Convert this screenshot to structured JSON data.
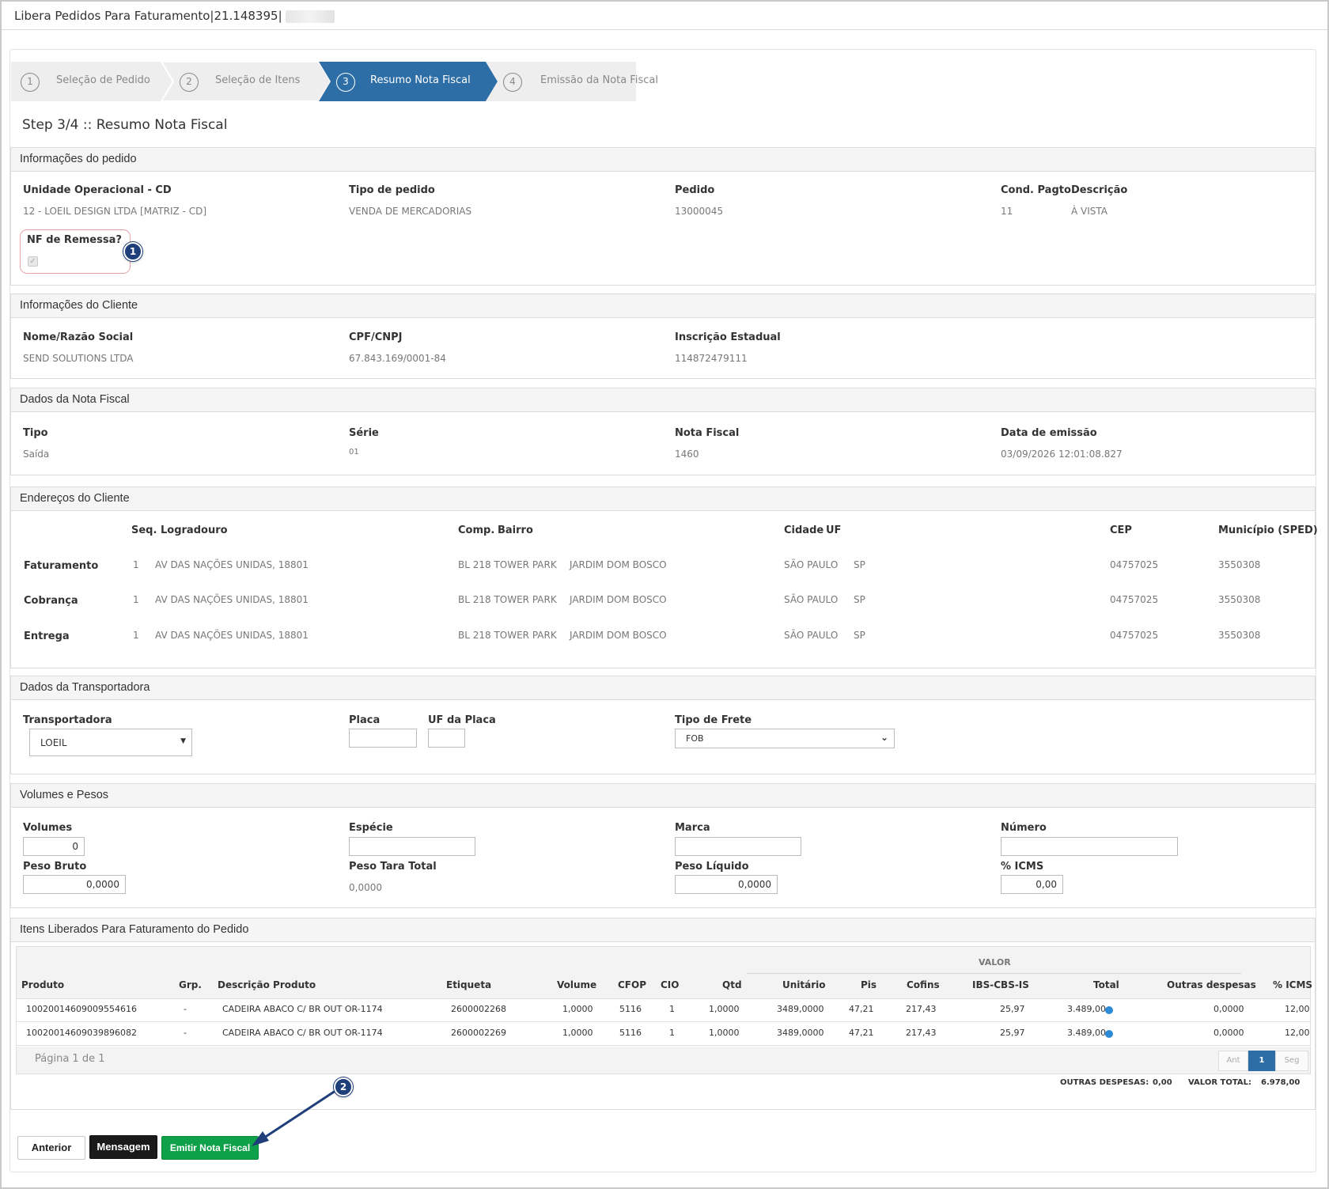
{
  "window": {
    "title": "Libera Pedidos Para Faturamento|21.148395|"
  },
  "wizard": {
    "steps": [
      {
        "num": "1",
        "label": "Seleção de Pedido"
      },
      {
        "num": "2",
        "label": "Seleção de Itens"
      },
      {
        "num": "3",
        "label": "Resumo Nota Fiscal"
      },
      {
        "num": "4",
        "label": "Emissão da Nota Fiscal"
      }
    ]
  },
  "step_title": "Step 3/4 :: Resumo Nota Fiscal",
  "pedido": {
    "header": "Informações do pedido",
    "unidade_label": "Unidade Operacional - CD",
    "unidade_value": "12 - LOEIL DESIGN LTDA [MATRIZ - CD]",
    "tipo_label": "Tipo de pedido",
    "tipo_value": "VENDA DE MERCADORIAS",
    "pedido_label": "Pedido",
    "pedido_value": "13000045",
    "cond_label": "Cond. Pagto",
    "cond_value": "11",
    "desc_label": "Descrição",
    "desc_value": "À VISTA",
    "remessa_label": "NF de Remessa?",
    "badge1": "1"
  },
  "cliente": {
    "header": "Informações do Cliente",
    "nome_label": "Nome/Razão Social",
    "nome_value": "SEND SOLUTIONS LTDA",
    "cpf_label": "CPF/CNPJ",
    "cpf_value": "67.843.169/0001-84",
    "ie_label": "Inscrição Estadual",
    "ie_value": "114872479111"
  },
  "nota": {
    "header": "Dados da Nota Fiscal",
    "tipo_label": "Tipo",
    "tipo_value": "Saída",
    "serie_label": "Série",
    "serie_value": "01",
    "nf_label": "Nota Fiscal",
    "nf_value": "1460",
    "data_label": "Data de emissão",
    "data_value": "03/09/2026 12:01:08.827"
  },
  "enderecos": {
    "header": "Endereços do Cliente",
    "cols": {
      "seq": "Seq.",
      "logradouro": "Logradouro",
      "comp": "Comp.",
      "bairro": "Bairro",
      "cidade": "Cidade",
      "uf": "UF",
      "cep": "CEP",
      "municipio": "Município (SPED)"
    },
    "rows": [
      {
        "tipo": "Faturamento",
        "seq": "1",
        "logradouro": "AV DAS NAÇÕES UNIDAS, 18801",
        "comp": "BL 218 TOWER PARK",
        "bairro": "JARDIM DOM BOSCO",
        "cidade": "SÃO PAULO",
        "uf": "SP",
        "cep": "04757025",
        "municipio": "3550308"
      },
      {
        "tipo": "Cobrança",
        "seq": "1",
        "logradouro": "AV DAS NAÇÕES UNIDAS, 18801",
        "comp": "BL 218 TOWER PARK",
        "bairro": "JARDIM DOM BOSCO",
        "cidade": "SÃO PAULO",
        "uf": "SP",
        "cep": "04757025",
        "municipio": "3550308"
      },
      {
        "tipo": "Entrega",
        "seq": "1",
        "logradouro": "AV DAS NAÇÕES UNIDAS, 18801",
        "comp": "BL 218 TOWER PARK",
        "bairro": "JARDIM DOM BOSCO",
        "cidade": "SÃO PAULO",
        "uf": "SP",
        "cep": "04757025",
        "municipio": "3550308"
      }
    ]
  },
  "transportadora": {
    "header": "Dados da Transportadora",
    "transp_label": "Transportadora",
    "transp_value": "LOEIL",
    "placa_label": "Placa",
    "placa_value": "",
    "uf_placa_label": "UF da Placa",
    "uf_placa_value": "",
    "frete_label": "Tipo de Frete",
    "frete_value": "FOB"
  },
  "volumes": {
    "header": "Volumes e Pesos",
    "volumes_label": "Volumes",
    "volumes_value": "0",
    "especie_label": "Espécie",
    "especie_value": "",
    "marca_label": "Marca",
    "marca_value": "",
    "numero_label": "Número",
    "numero_value": "",
    "peso_bruto_label": "Peso Bruto",
    "peso_bruto_value": "0,0000",
    "peso_tara_label": "Peso Tara Total",
    "peso_tara_value": "0,0000",
    "peso_liquido_label": "Peso Líquido",
    "peso_liquido_value": "0,0000",
    "icms_label": "% ICMS",
    "icms_value": "0,00"
  },
  "itens": {
    "header": "Itens Liberados Para Faturamento do Pedido",
    "group_header": "VALOR",
    "cols": {
      "produto": "Produto",
      "grp": "Grp.",
      "descricao": "Descrição Produto",
      "etiqueta": "Etiqueta",
      "volume": "Volume",
      "cfop": "CFOP",
      "cio": "CIO",
      "qtd": "Qtd",
      "unitario": "Unitário",
      "pis": "Pis",
      "cofins": "Cofins",
      "ibs": "IBS-CBS-IS",
      "total": "Total",
      "outras": "Outras despesas",
      "icms": "% ICMS"
    },
    "rows": [
      {
        "produto": "10020014609009554616",
        "grp": "-",
        "descricao": "CADEIRA ABACO C/ BR OUT OR-1174",
        "etiqueta": "2600002268",
        "volume": "1,0000",
        "cfop": "5116",
        "cio": "1",
        "qtd": "1,0000",
        "unitario": "3489,0000",
        "pis": "47,21",
        "cofins": "217,43",
        "ibs": "25,97",
        "total": "3.489,00",
        "outras": "0,0000",
        "icms": "12,00"
      },
      {
        "produto": "10020014609039896082",
        "grp": "-",
        "descricao": "CADEIRA ABACO C/ BR OUT OR-1174",
        "etiqueta": "2600002269",
        "volume": "1,0000",
        "cfop": "5116",
        "cio": "1",
        "qtd": "1,0000",
        "unitario": "3489,0000",
        "pis": "47,21",
        "cofins": "217,43",
        "ibs": "25,97",
        "total": "3.489,00",
        "outras": "0,0000",
        "icms": "12,00"
      }
    ],
    "pagination": {
      "info": "Página 1 de 1",
      "prev": "Ant",
      "current": "1",
      "next": "Seg"
    },
    "totals": {
      "outras_label": "OUTRAS DESPESAS:",
      "outras_value": "0,00",
      "total_label": "VALOR TOTAL:",
      "total_value": "6.978,00"
    }
  },
  "actions": {
    "anterior": "Anterior",
    "mensagem": "Mensagem",
    "emitir": "Emitir Nota Fiscal",
    "badge2": "2"
  },
  "colors": {
    "wizard_active": "#2e6ea6",
    "emitir_button": "#0fa14a",
    "badge": "#1f3f7a",
    "info_dot": "#2d8ad6"
  }
}
